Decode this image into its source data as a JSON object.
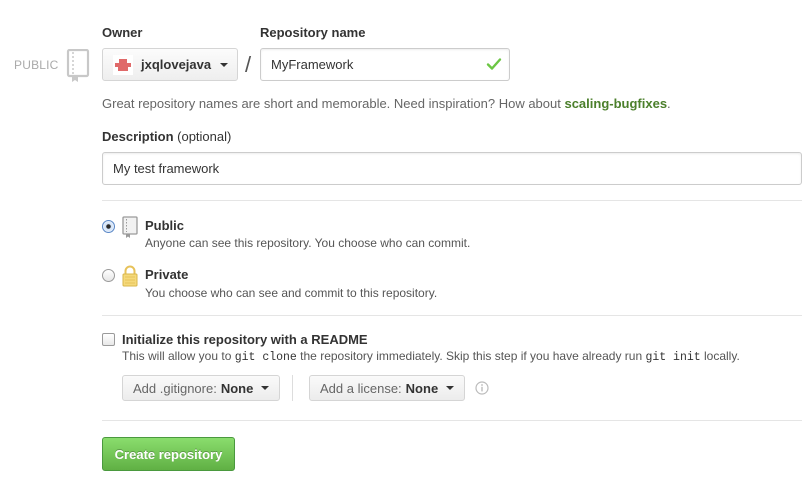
{
  "visibility_indicator": {
    "label": "PUBLIC",
    "icon": "repo-book-icon"
  },
  "owner": {
    "label": "Owner",
    "value": "jxqlovejava"
  },
  "repository_name": {
    "label": "Repository name",
    "value": "MyFramework",
    "valid_icon": "check-icon"
  },
  "separator": "/",
  "hint": {
    "text": "Great repository names are short and memorable. Need inspiration? How about ",
    "suggestion": "scaling-bugfixes",
    "suffix": "."
  },
  "description": {
    "label": "Description",
    "optional": "(optional)",
    "value": "My test framework"
  },
  "visibility_options": [
    {
      "title": "Public",
      "description": "Anyone can see this repository. You choose who can commit.",
      "checked": true,
      "icon": "repo-book-icon"
    },
    {
      "title": "Private",
      "description": "You choose who can see and commit to this repository.",
      "checked": false,
      "icon": "lock-icon"
    }
  ],
  "readme": {
    "title": "Initialize this repository with a README",
    "desc_part1": "This will allow you to ",
    "code1": "git clone",
    "desc_part2": " the repository immediately. Skip this step if you have already run ",
    "code2": "git init",
    "desc_part3": " locally.",
    "checked": false
  },
  "gitignore": {
    "label": "Add .gitignore:",
    "value": "None"
  },
  "license": {
    "label": "Add a license:",
    "value": "None"
  },
  "create_button": "Create repository",
  "colors": {
    "success": "#6cc644",
    "button_green": "#60b044",
    "link_green": "#4b7f2b"
  }
}
